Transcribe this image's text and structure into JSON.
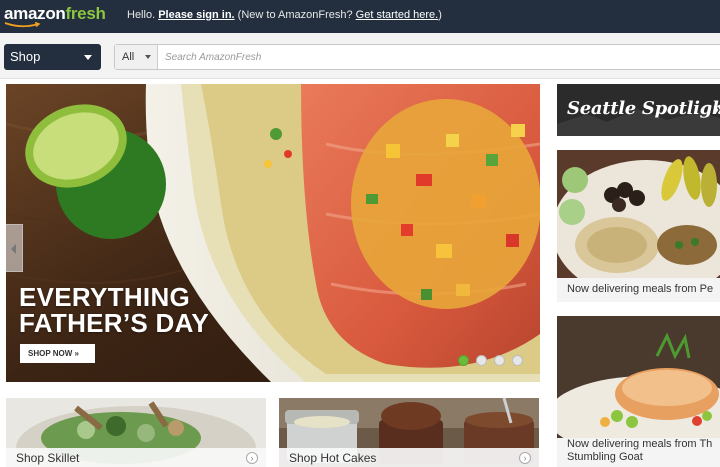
{
  "header": {
    "logo_amazon": "amazon",
    "logo_fresh": "fresh",
    "greeting_hello": "Hello.",
    "greeting_signin": "Please sign in.",
    "greeting_new": "(New to AmazonFresh?",
    "greeting_started": "Get started here.",
    "greeting_close": ")"
  },
  "nav": {
    "shop_label": "Shop",
    "search_category": "All",
    "search_placeholder": "Search AmazonFresh"
  },
  "hero": {
    "title_line1": "EVERYTHING",
    "title_line2": "FATHER’S DAY",
    "cta": "SHOP NOW »",
    "slide_count": 4,
    "active_slide": 1
  },
  "sidebar": {
    "spotlight_title": "Seattle Spotlight",
    "spotlight_arrow": "»",
    "card1_caption": "Now delivering meals from Pe",
    "card2_caption_line1": "Now delivering meals from Th",
    "card2_caption_line2": "Stumbling Goat"
  },
  "bottom": {
    "card1_label": "Shop Skillet",
    "card2_label": "Shop Hot Cakes"
  },
  "colors": {
    "header_bg": "#232f3e",
    "brand_green": "#8cc63f",
    "active_dot": "#6dba3a"
  },
  "icons": {
    "shop_dropdown": "chevron-down-icon",
    "search_category": "chevron-down-icon",
    "slider_prev": "chevron-left-icon",
    "card_more": "chevron-right-icon"
  }
}
